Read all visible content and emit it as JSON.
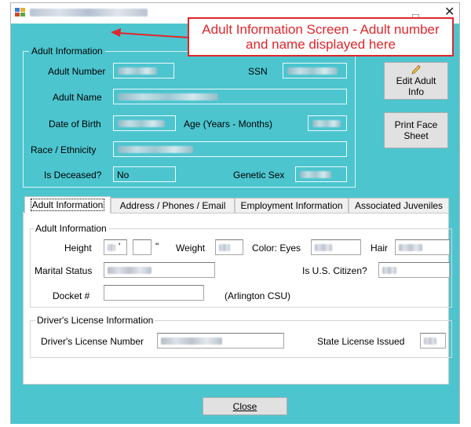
{
  "annotation": {
    "callout_text": "Adult Information Screen - Adult number and name displayed here"
  },
  "window": {
    "close_glyph": "✕"
  },
  "adult_info": {
    "group_title": "Adult Information",
    "adult_number_label": "Adult Number",
    "ssn_label": "SSN",
    "adult_name_label": "Adult Name",
    "dob_label": "Date of Birth",
    "age_label": "Age (Years - Months)",
    "race_label": "Race / Ethnicity",
    "deceased_label": "Is Deceased?",
    "deceased_value": "No",
    "genetic_sex_label": "Genetic Sex"
  },
  "buttons": {
    "edit_adult_line1": "Edit Adult",
    "edit_adult_line2": "Info",
    "print_face_line1": "Print Face",
    "print_face_line2": "Sheet",
    "close_label": "Close"
  },
  "tabs": [
    {
      "label": "Adult Information"
    },
    {
      "label": "Address / Phones / Email"
    },
    {
      "label": "Employment Information"
    },
    {
      "label": "Associated Juveniles"
    }
  ],
  "tab_adult": {
    "group_title": "Adult Information",
    "height_label": "Height",
    "feet_mark": "'",
    "inches_mark": "\"",
    "weight_label": "Weight",
    "eyes_label": "Color: Eyes",
    "hair_label": "Hair",
    "marital_label": "Marital Status",
    "citizen_label": "Is U.S. Citizen?",
    "docket_label": "Docket #",
    "docket_value": "",
    "csu_label": "(Arlington CSU)"
  },
  "drivers_license": {
    "group_title": "Driver's License Information",
    "number_label": "Driver's License Number",
    "state_label": "State License Issued"
  },
  "colors": {
    "accent": "#4cc5cf",
    "annotation": "#e0262b"
  },
  "icons": [
    "app-icon",
    "close-icon",
    "maximize-icon",
    "edit-pencil-icon",
    "annotation-arrow"
  ]
}
